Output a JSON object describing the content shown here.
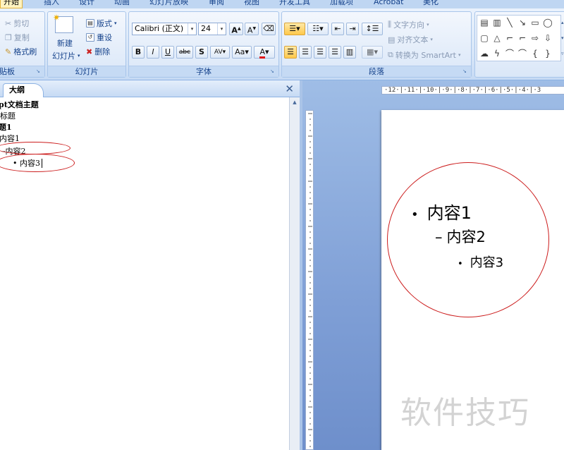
{
  "ribbon_tabs": [
    "开始",
    "插入",
    "设计",
    "动画",
    "幻灯片放映",
    "审阅",
    "视图",
    "开发工具",
    "加载项",
    "Acrobat",
    "美化"
  ],
  "clipboard": {
    "cut": "剪切",
    "copy": "复制",
    "format_painter": "格式刷",
    "group_label": "贴板"
  },
  "slides_group": {
    "new_slide_line1": "新建",
    "new_slide_line2": "幻灯片",
    "layout": "版式",
    "reset": "重设",
    "delete": "删除",
    "group_label": "幻灯片"
  },
  "font_group": {
    "font_name": "Calibri (正文)",
    "font_size": "24",
    "grow": "A",
    "shrink": "A",
    "bold": "B",
    "italic": "I",
    "underline": "U",
    "strike": "abc",
    "shadow": "S",
    "spacing": "AV",
    "case": "Aa",
    "color": "A",
    "group_label": "字体"
  },
  "paragraph_group": {
    "text_direction": "文字方向",
    "align_text": "对齐文本",
    "smartart": "转换为 SmartArt",
    "group_label": "段落"
  },
  "outline_pane": {
    "tab_label": "大纲",
    "close": "✕",
    "lines": [
      "pt文档主题",
      "标题",
      "题1",
      "内容1",
      "–内容2",
      "• 内容3"
    ]
  },
  "ruler": {
    "h_text": "·12·|·11·|·10·|·9·|·8·|·7·|·6·|·5·|·4·|·3"
  },
  "slide": {
    "bullets": [
      {
        "marker": "•",
        "text": "内容1"
      },
      {
        "marker": "–",
        "text": "内容2"
      },
      {
        "marker": "•",
        "text": "内容3"
      }
    ]
  },
  "watermark": "软件技巧",
  "colors": {
    "accent": "#15428b",
    "mark": "#cc1d1d",
    "font_color_bar": "#e01010"
  }
}
